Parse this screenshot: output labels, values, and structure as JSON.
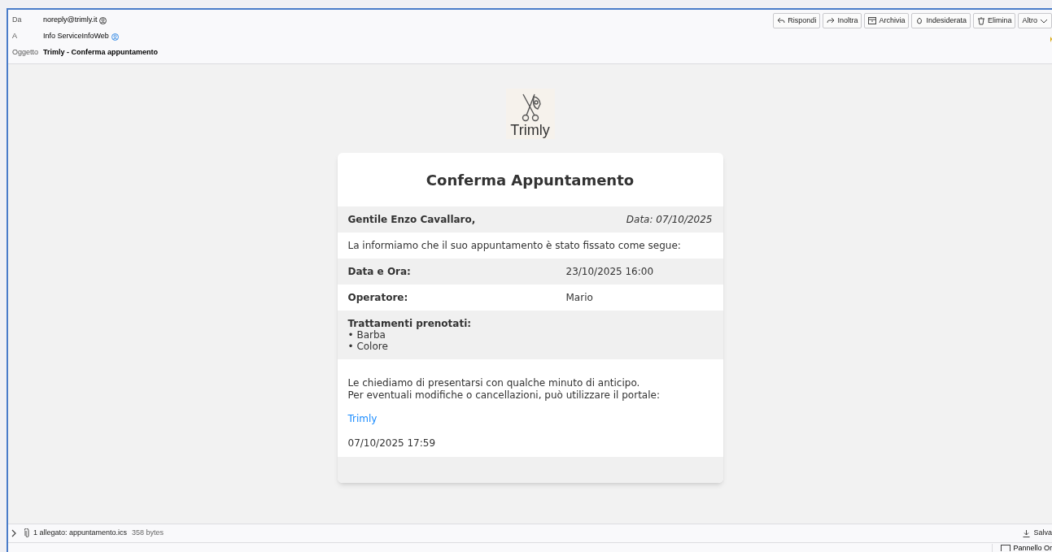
{
  "header": {
    "fields": [
      {
        "label": "Da",
        "value": "noreply@trimly.it",
        "kind": "sender"
      },
      {
        "label": "A",
        "value": "Info ServiceInfoWeb",
        "kind": "recipient"
      },
      {
        "label": "Oggetto",
        "value": "Trimly - Conferma appuntamento",
        "kind": "subject"
      }
    ],
    "actions": [
      {
        "label": "Rispondi",
        "kind": "reply"
      },
      {
        "label": "Inoltra",
        "kind": "forward"
      },
      {
        "label": "Archivia",
        "kind": "archive"
      },
      {
        "label": "Indesiderata",
        "kind": "junk"
      },
      {
        "label": "Elimina",
        "kind": "trash"
      },
      {
        "label": "Altro",
        "kind": "menu"
      }
    ]
  },
  "email": {
    "logo_text": "Trimly",
    "title": "Conferma Appuntamento",
    "greeting": "Gentile Enzo Cavallaro,",
    "date": "Data: 07/10/2025",
    "intro": "La informiamo che il suo appuntamento è stato fissato come segue:",
    "details": [
      {
        "label": "Data e Ora:",
        "value": "23/10/2025 16:00"
      },
      {
        "label": "Operatore:",
        "value": "Mario"
      }
    ],
    "treatments_label": "Trattamenti prenotati:",
    "treatments": [
      "• Barba",
      "• Colore"
    ],
    "note_lines": [
      "Le chiediamo di presentarsi con qualche minuto di anticipo.",
      "Per eventuali modifiche o cancellazioni, può utilizzare il portale:"
    ],
    "link": "Trimly",
    "timestamp": "07/10/2025 17:59"
  },
  "attachments": {
    "summary": "1 allegato: appuntamento.ics",
    "size": "358 bytes",
    "save": "Salva",
    "expanded": false
  },
  "bottom": {
    "panel": "Pannello Or"
  }
}
